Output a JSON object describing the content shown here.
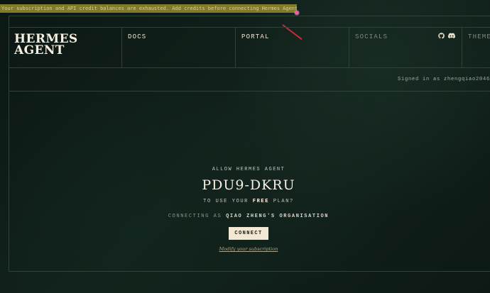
{
  "banner": {
    "message": "Your subscription and API credit balances are exhausted. Add credits before connecting Hermes Agent."
  },
  "brand": {
    "line1": "HERMES",
    "line2": "AGENT"
  },
  "nav": {
    "items": [
      {
        "label": "DOCS"
      },
      {
        "label": "PORTAL"
      },
      {
        "label": "SOCIALS"
      },
      {
        "label": "THEME"
      }
    ]
  },
  "account": {
    "signed_in": "Signed in as zhengqiao2046"
  },
  "auth": {
    "allow_label": "ALLOW HERMES AGENT",
    "device_code": "PDU9-DKRU",
    "plan_prefix": "TO USE YOUR",
    "plan_name": "FREE",
    "plan_suffix": "PLAN?",
    "connecting_prefix": "CONNECTING AS",
    "organisation": "QIAO ZHENG'S ORGANISATION",
    "connect_label": "CONNECT",
    "modify_label": "Modify your subscription"
  },
  "icons": {
    "github": "github-icon",
    "discord": "discord-icon"
  },
  "colors": {
    "background": "#0f1b16",
    "banner": "#807a2a",
    "button": "#f4e7d3",
    "pointer": "#f25fa0"
  }
}
